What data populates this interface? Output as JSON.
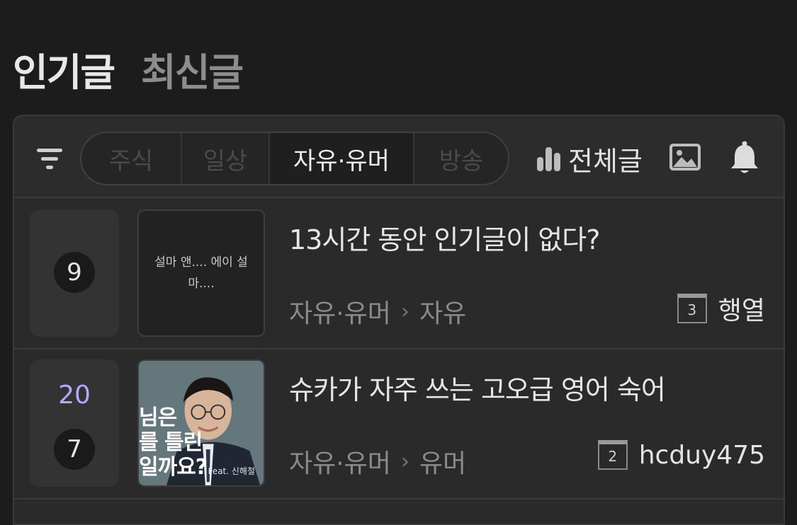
{
  "top_tabs": {
    "popular": "인기글",
    "latest": "최신글"
  },
  "toolbar": {
    "segments": [
      {
        "label": "주식",
        "active": false
      },
      {
        "label": "일상",
        "active": false
      },
      {
        "label": "자유·유머",
        "active": true
      },
      {
        "label": "방송",
        "active": false
      }
    ],
    "all_posts_label": "전체글",
    "icons": [
      "filter-icon",
      "bar-chart-icon",
      "image-icon",
      "bell-icon"
    ]
  },
  "posts": [
    {
      "rank": "9",
      "rank_change": "",
      "thumb_text": "설마 앤.... 에이 설마....",
      "title": "13시간 동안 인기글이 없다?",
      "category": "자유·유머",
      "subcategory": "자유",
      "level": "3",
      "author": "행열"
    },
    {
      "rank": "7",
      "rank_change": "20",
      "thumb_overlay_lines": [
        "님은",
        "를 틀린",
        "일까요?"
      ],
      "thumb_feat": "Feat. 신해철",
      "title": "슈카가 자주 쓰는 고오급 영어 숙어",
      "category": "자유·유머",
      "subcategory": "유머",
      "level": "2",
      "author": "hcduy475"
    }
  ],
  "colors": {
    "accent": "#b8a6ff",
    "background": "#1c1c1d",
    "panel": "#2a2a2b"
  }
}
